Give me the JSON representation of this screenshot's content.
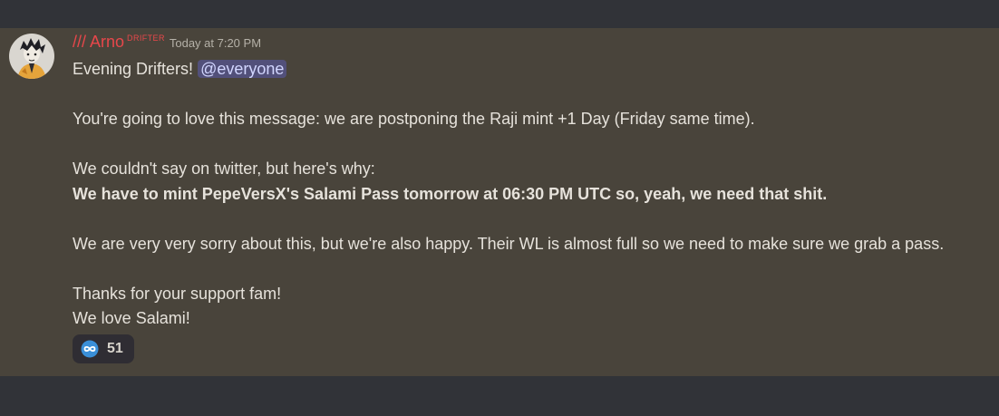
{
  "message": {
    "author": {
      "name": "/// Arno",
      "role_tag": "DRIFTER",
      "name_color": "#e8474b"
    },
    "timestamp": "Today at 7:20 PM",
    "lines": [
      {
        "text": "Evening Drifters! ",
        "mention": "@everyone"
      },
      {
        "text": ""
      },
      {
        "text": "You're going to love this message: we are postponing the Raji mint +1 Day (Friday same time)."
      },
      {
        "text": ""
      },
      {
        "text": "We couldn't say on twitter, but here's why:"
      },
      {
        "text": "We have to mint PepeVersX's Salami Pass tomorrow at 06:30 PM UTC so, yeah, we need that shit.",
        "bold": true
      },
      {
        "text": ""
      },
      {
        "text": "We are very very sorry about this, but we're also happy. Their WL is almost full so we need to make sure we grab a pass."
      },
      {
        "text": ""
      },
      {
        "text": "Thanks for your support fam!"
      },
      {
        "text": "We love Salami!"
      }
    ],
    "reaction": {
      "emoji": "infinity-emoji",
      "count": "51"
    }
  },
  "colors": {
    "page_background": "#313338",
    "highlighted_message_background": "#49443b",
    "mention_background": "#52507a",
    "mention_text": "#d2d6ff",
    "reaction_background": "#2f2d33"
  }
}
